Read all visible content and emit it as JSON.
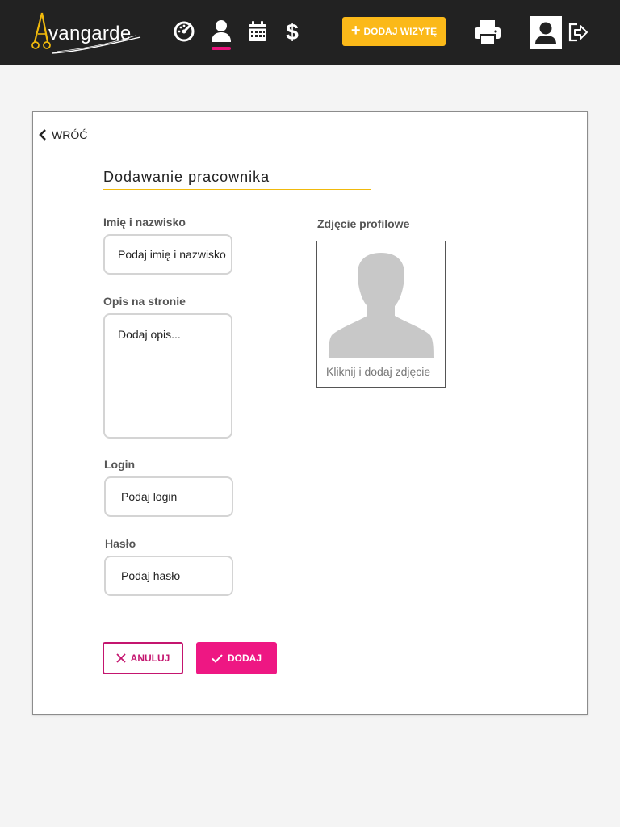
{
  "header": {
    "logo_text": "vangarde",
    "add_visit_label": "DODAJ WIZYTĘ",
    "nav": [
      {
        "icon": "speedometer-icon",
        "active": false
      },
      {
        "icon": "person-icon",
        "active": true
      },
      {
        "icon": "calendar-icon",
        "active": false
      },
      {
        "icon": "dollar-icon",
        "active": false
      }
    ]
  },
  "form": {
    "back_label": "WRÓĆ",
    "title": "Dodawanie pracownika",
    "name": {
      "label": "Imię i nazwisko",
      "placeholder": "Podaj imię i nazwisko"
    },
    "description": {
      "label": "Opis na stronie",
      "placeholder": "Dodaj opis..."
    },
    "login": {
      "label": "Login",
      "placeholder": "Podaj login"
    },
    "password": {
      "label": "Hasło",
      "placeholder": "Podaj hasło"
    },
    "photo": {
      "label": "Zdjęcie profilowe",
      "caption": "Kliknij i dodaj zdjęcie"
    },
    "cancel_label": "ANULUJ",
    "submit_label": "DODAJ"
  },
  "colors": {
    "topbar": "#222222",
    "accent_yellow": "#fbb919",
    "accent_pink": "#ee1783",
    "cancel_pink": "#c4156f",
    "title_underline": "#f0b90c"
  }
}
